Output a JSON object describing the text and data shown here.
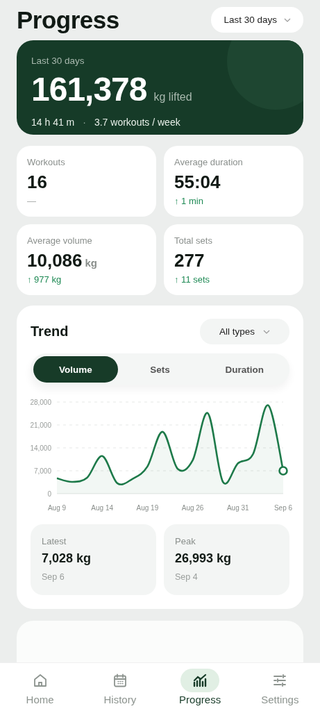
{
  "header": {
    "title": "Progress",
    "range_picker": "Last 30 days"
  },
  "summary": {
    "label": "Last 30 days",
    "total": "161,378",
    "unit": "kg lifted",
    "duration": "14 h 41 m",
    "separator": "·",
    "frequency": "3.7 workouts / week"
  },
  "stats": [
    {
      "label": "Workouts",
      "value": "16",
      "change": "—",
      "kind": "flat"
    },
    {
      "label": "Average duration",
      "value": "55:04",
      "change": "↑ 1 min",
      "kind": "up"
    },
    {
      "label": "Average volume",
      "value": "10,086",
      "unit": "kg",
      "change": "↑ 977 kg",
      "kind": "up"
    },
    {
      "label": "Total sets",
      "value": "277",
      "change": "↑ 11 sets",
      "kind": "up"
    }
  ],
  "trend": {
    "title": "Trend",
    "filter": "All types",
    "tabs": [
      {
        "label": "Volume",
        "selected": true
      },
      {
        "label": "Sets",
        "selected": false
      },
      {
        "label": "Duration",
        "selected": false
      }
    ],
    "chart_data": {
      "type": "area",
      "categories": [
        "Aug 9",
        null,
        null,
        "Aug 14",
        null,
        null,
        "Aug 19",
        null,
        null,
        "Aug 26",
        null,
        null,
        "Aug 31",
        null,
        null,
        "Sep 6"
      ],
      "series": [
        {
          "color": "#1e7a4a",
          "values": [
            4700,
            3600,
            4900,
            11500,
            3200,
            4500,
            8300,
            18900,
            7600,
            10200,
            24600,
            3600,
            9300,
            12100,
            27000,
            7000
          ]
        }
      ],
      "ylim": [
        0,
        28000
      ],
      "grid": true,
      "yticks": [
        {
          "value": 0,
          "label": "0"
        },
        {
          "value": 7000,
          "label": "7,000"
        },
        {
          "value": 14000,
          "label": "14,000"
        },
        {
          "value": 21000,
          "label": "21,000"
        },
        {
          "value": 28000,
          "label": "28,000"
        }
      ]
    },
    "highlights": [
      {
        "label": "Latest",
        "value": "7,028 kg",
        "date": "Sep 6"
      },
      {
        "label": "Peak",
        "value": "26,993 kg",
        "date": "Sep 4"
      }
    ]
  },
  "nav": [
    {
      "label": "Home",
      "kind": "home",
      "selected": false
    },
    {
      "label": "History",
      "kind": "calendar",
      "selected": false
    },
    {
      "label": "Progress",
      "kind": "chart",
      "selected": true
    },
    {
      "label": "Settings",
      "kind": "sliders",
      "selected": false
    }
  ]
}
